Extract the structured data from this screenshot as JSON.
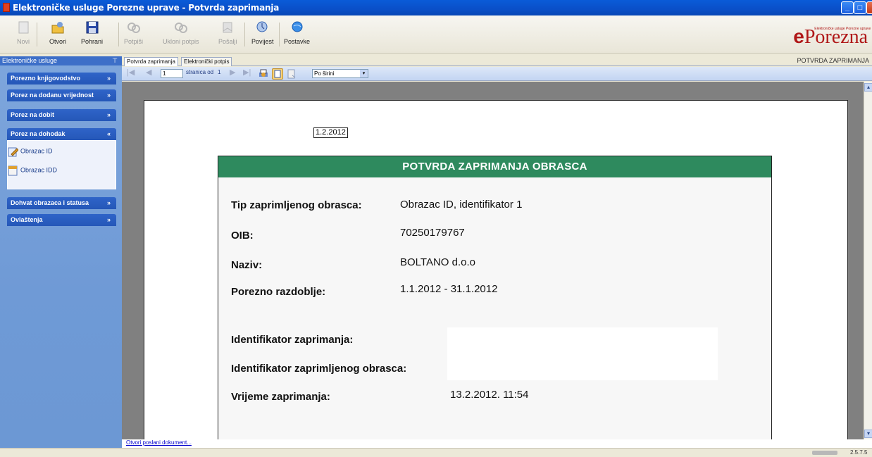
{
  "window": {
    "title": "Elektroničke usluge Porezne uprave - Potvrda zaprimanja",
    "buttons": {
      "minimize": "_",
      "maximize": "□",
      "close": "✕"
    }
  },
  "toolbar": {
    "items": [
      {
        "label": "Novi",
        "icon": "new-document-icon",
        "enabled": false
      },
      {
        "label": "Otvori",
        "icon": "open-folder-icon",
        "enabled": true
      },
      {
        "label": "Pohrani",
        "icon": "save-disk-icon",
        "enabled": true
      },
      {
        "label": "Potpiši",
        "icon": "sign-icon",
        "enabled": false
      },
      {
        "label": "Ukloni potpis",
        "icon": "remove-signature-icon",
        "enabled": false
      },
      {
        "label": "Pošalji",
        "icon": "send-icon",
        "enabled": false
      },
      {
        "label": "Povijest",
        "icon": "history-icon",
        "enabled": true
      },
      {
        "label": "Postavke",
        "icon": "settings-globe-icon",
        "enabled": true
      }
    ],
    "logo": {
      "prefix": "e",
      "text": "Porezna",
      "tagline": "Elektroničke usluge Porezne uprave"
    }
  },
  "sidebar": {
    "header": "Elektroničke usluge",
    "pin": "⊤",
    "groups": [
      {
        "label": "Porezno knjigovodstvo",
        "chevron": "»"
      },
      {
        "label": "Porez na dodanu vrijednost",
        "chevron": "»"
      },
      {
        "label": "Porez na dobit",
        "chevron": "»"
      },
      {
        "label": "Porez na dohodak",
        "chevron": "«"
      },
      {
        "label": "Dohvat obrazaca i statusa",
        "chevron": "»"
      },
      {
        "label": "Ovlaštenja",
        "chevron": "»"
      }
    ],
    "open_group_items": [
      "Obrazac ID",
      "Obrazac IDD"
    ]
  },
  "tabs": [
    "Potvrda zaprimanja",
    "Elektronički potpis"
  ],
  "tab_right_title": "POTVRDA ZAPRIMANJA",
  "viewer_toolbar": {
    "page_value": "1",
    "page_text": "stranica od",
    "page_total": "1",
    "zoom": "Po širini"
  },
  "document": {
    "date": "1.2.2012",
    "header": "POTVRDA ZAPRIMANJA OBRASCA",
    "fields": {
      "tip_label": "Tip zaprimljenog obrasca:",
      "tip_value": "Obrazac ID, identifikator 1",
      "oib_label": "OIB:",
      "oib_value": "70250179767",
      "naziv_label": "Naziv:",
      "naziv_value": "BOLTANO d.o.o",
      "razdoblje_label": "Porezno razdoblje:",
      "razdoblje_value": "1.1.2012 - 31.1.2012",
      "ident_zaprimanja_label": "Identifikator zaprimanja:",
      "ident_obrasca_label": "Identifikator zaprimljenog obrasca:",
      "vrijeme_label": "Vrijeme zaprimanja:",
      "vrijeme_value": "13.2.2012. 11:54"
    }
  },
  "bottom_link": "Otvori poslani dokument...",
  "status": {
    "version": "2.5.7.5"
  }
}
